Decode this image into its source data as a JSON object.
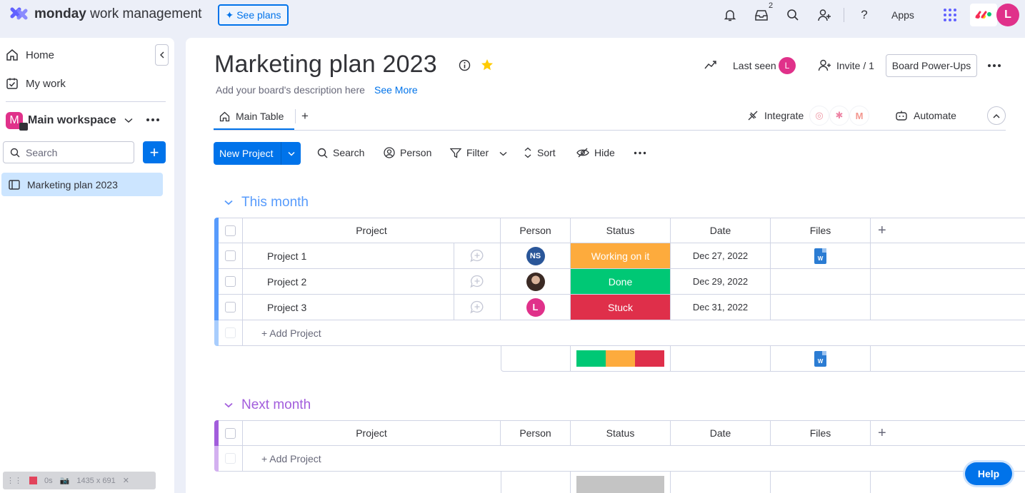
{
  "topbar": {
    "brand_bold": "monday",
    "brand_rest": " work management",
    "see_plans": "See plans",
    "inbox_badge": "2",
    "apps_label": "Apps",
    "user_initial": "L"
  },
  "sidebar": {
    "home": "Home",
    "my_work": "My work",
    "workspace_initial": "M",
    "workspace_name": "Main workspace",
    "search_placeholder": "Search",
    "boards": [
      "Marketing plan 2023"
    ]
  },
  "board": {
    "title": "Marketing plan 2023",
    "description": "Add your board's description here",
    "see_more": "See More",
    "last_seen": "Last seen",
    "last_seen_initial": "L",
    "invite": "Invite / 1",
    "power_ups": "Board Power-Ups",
    "tab_main": "Main Table",
    "integrate": "Integrate",
    "automate": "Automate"
  },
  "toolbar": {
    "new_item": "New Project",
    "search": "Search",
    "person": "Person",
    "filter": "Filter",
    "sort": "Sort",
    "hide": "Hide"
  },
  "columns": [
    "Project",
    "Person",
    "Status",
    "Date",
    "Files"
  ],
  "groups": [
    {
      "title": "This month",
      "color": "#579bfc",
      "add_label": "+ Add Project",
      "rows": [
        {
          "name": "Project 1",
          "person": "NS",
          "status": "Working on it",
          "status_color": "#fdab3d",
          "date": "Dec 27, 2022",
          "file": "W"
        },
        {
          "name": "Project 2",
          "person": "photo",
          "status": "Done",
          "status_color": "#00c875",
          "date": "Dec 29, 2022",
          "file": ""
        },
        {
          "name": "Project 3",
          "person": "L",
          "status": "Stuck",
          "status_color": "#df2f4a",
          "date": "Dec 31, 2022",
          "file": ""
        }
      ],
      "summary_file": "W"
    },
    {
      "title": "Next month",
      "color": "#a25ddc",
      "add_label": "+ Add Project",
      "rows": []
    }
  ],
  "recorder": {
    "time": "0s",
    "size": "1435 x 691"
  },
  "help": "Help"
}
